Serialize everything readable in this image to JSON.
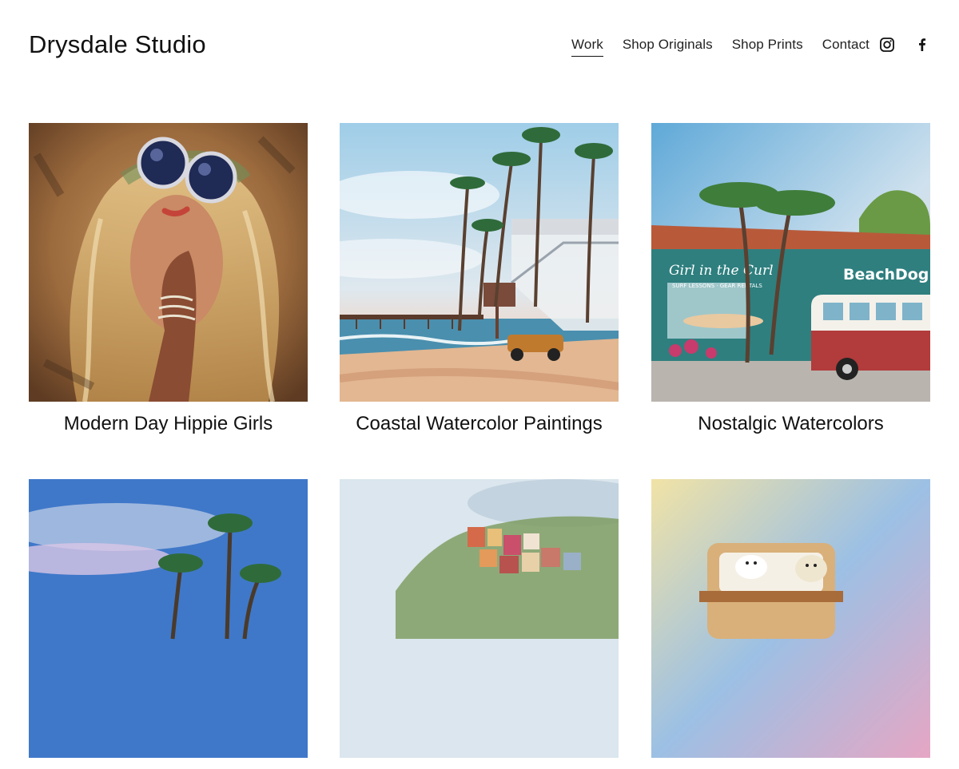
{
  "site": {
    "title": "Drysdale Studio"
  },
  "nav": {
    "items": [
      {
        "label": "Work",
        "active": true
      },
      {
        "label": "Shop Originals",
        "active": false
      },
      {
        "label": "Shop Prints",
        "active": false
      },
      {
        "label": "Contact",
        "active": false
      }
    ],
    "social": [
      "instagram-icon",
      "facebook-icon"
    ]
  },
  "gallery": {
    "items": [
      {
        "title": "Modern Day Hippie Girls"
      },
      {
        "title": "Coastal Watercolor Paintings"
      },
      {
        "title": "Nostalgic Watercolors"
      },
      {
        "title": ""
      },
      {
        "title": ""
      },
      {
        "title": ""
      }
    ]
  },
  "artwork_text": {
    "shop_sign_left": "Girl in the Curl",
    "shop_sign_left_sub": "SURF LESSONS · GEAR RENTALS",
    "shop_sign_right": "BeachDog"
  }
}
